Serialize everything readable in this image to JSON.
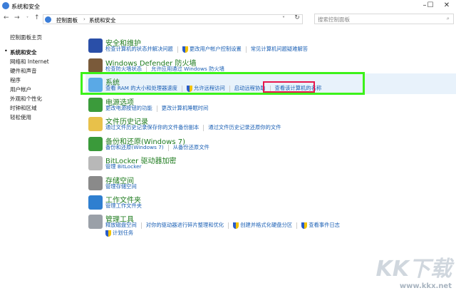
{
  "window": {
    "title": "系统和安全"
  },
  "address": {
    "crumbs": [
      "控制面板",
      "系统和安全"
    ]
  },
  "search": {
    "placeholder": "搜索控制面板"
  },
  "sidebar": {
    "items": [
      "控制面板主页",
      "系统和安全",
      "网络和 Internet",
      "硬件和声音",
      "程序",
      "用户帐户",
      "外观和个性化",
      "时钟和区域",
      "轻松使用"
    ]
  },
  "categories": [
    {
      "title": "安全和维护",
      "links": [
        {
          "t": "检查计算机的状态并解决问题"
        },
        {
          "t": "更改用户帐户控制设置",
          "shield": true
        },
        {
          "t": "常见计算机问题疑难解答"
        }
      ]
    },
    {
      "title": "Windows Defender 防火墙",
      "links": [
        {
          "t": "检查防火墙状态"
        },
        {
          "t": "允许应用通过 Windows 防火墙"
        }
      ]
    },
    {
      "title": "系统",
      "links": [
        {
          "t": "查看 RAM 的大小和处理器速度"
        },
        {
          "t": "允许远程访问",
          "shield": true
        },
        {
          "t": "启动远程协助"
        },
        {
          "t": "查看该计算机的名称"
        }
      ]
    },
    {
      "title": "电源选项",
      "links": [
        {
          "t": "更改电源按钮的功能"
        },
        {
          "t": "更改计算机睡眠时间"
        }
      ]
    },
    {
      "title": "文件历史记录",
      "links": [
        {
          "t": "通过文件历史记录保存你的文件备份副本"
        },
        {
          "t": "通过文件历史记录还原你的文件"
        }
      ]
    },
    {
      "title": "备份和还原(Windows 7)",
      "links": [
        {
          "t": "备份和还原(Windows 7)"
        },
        {
          "t": "从备份还原文件"
        }
      ]
    },
    {
      "title": "BitLocker 驱动器加密",
      "links": [
        {
          "t": "管理 BitLocker"
        }
      ]
    },
    {
      "title": "存储空间",
      "links": [
        {
          "t": "管理存储空间"
        }
      ]
    },
    {
      "title": "工作文件夹",
      "links": [
        {
          "t": "管理工作文件夹"
        }
      ]
    },
    {
      "title": "管理工具",
      "links": [
        {
          "t": "释放磁盘空间"
        },
        {
          "t": "对你的驱动器进行碎片整理和优化"
        },
        {
          "t": "创建并格式化硬盘分区",
          "shield": true
        },
        {
          "t": "查看事件日志",
          "shield": true
        }
      ],
      "links2": [
        {
          "t": "计划任务",
          "shield": true
        }
      ]
    }
  ],
  "watermark": {
    "brand": "KK下载",
    "url": "www.kkx.net"
  },
  "colors": {
    "title": "#1e7b1e",
    "link": "#1a5fb4",
    "green_box": "#3cf21a",
    "red_box": "#e8174c"
  }
}
